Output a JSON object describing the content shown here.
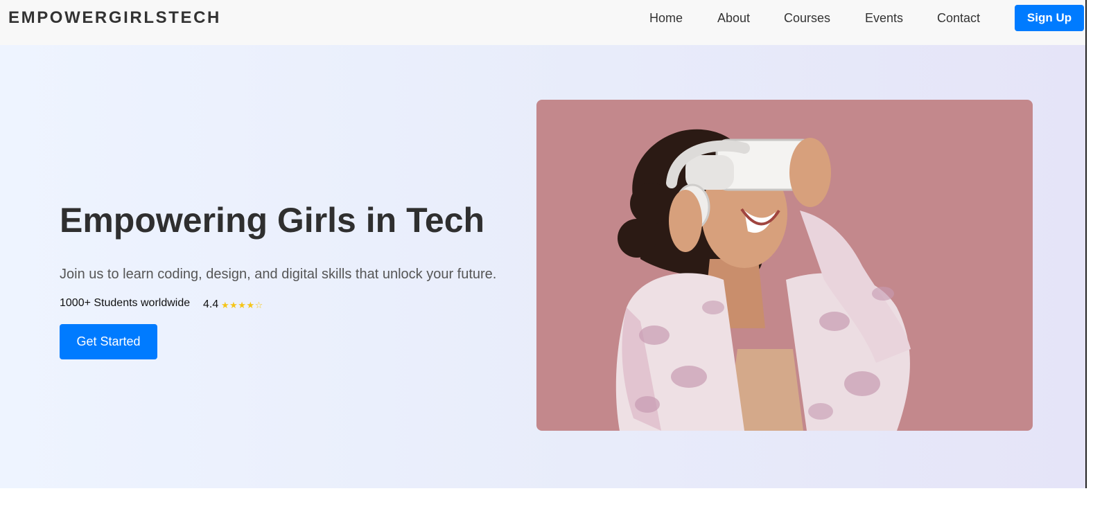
{
  "header": {
    "logo": "EMPOWERGIRLSTECH",
    "nav": [
      "Home",
      "About",
      "Courses",
      "Events",
      "Contact"
    ],
    "signup_label": "Sign Up"
  },
  "hero": {
    "title": "Empowering Girls in Tech",
    "subtitle": "Join us to learn coding, design, and digital skills that unlock your future.",
    "students": "1000+ Students worldwide",
    "rating": "4.4",
    "stars": "★★★★☆",
    "cta_label": "Get Started"
  },
  "colors": {
    "accent": "#007bff",
    "image_bg": "#c3888c",
    "star": "#f5c518"
  }
}
